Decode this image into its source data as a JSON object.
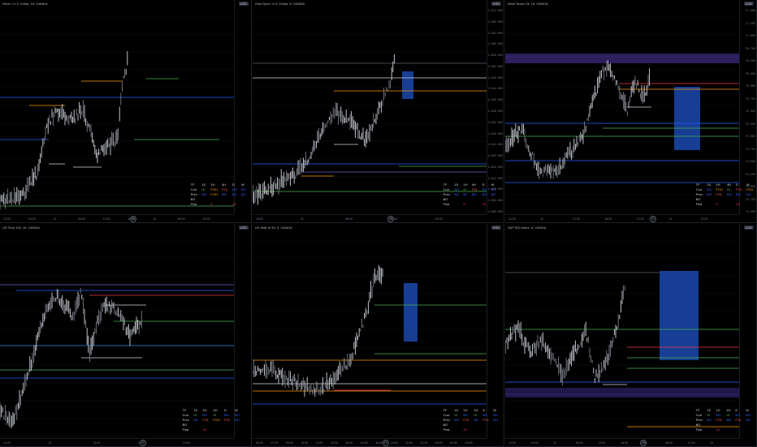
{
  "panels": [
    {
      "id": "silver",
      "title": "Silver / U.S. Dollar, 15, OANDA",
      "axis_badge": "USD",
      "price_ticks": [],
      "time_labels": [
        "12:00",
        "18:00",
        "11",
        "06:00",
        "12:00",
        "18:00",
        "14",
        "06:00",
        "12:00"
      ],
      "hud": {
        "header": [
          "TF",
          "15",
          "1H",
          "4H",
          "D",
          "W"
        ],
        "rows": [
          {
            "label": "Curr",
            "cells": [
              "HI",
              "FOH",
              "FOL",
              "BO",
              "BO"
            ]
          },
          {
            "label": "Prev",
            "cells": [
              "BO",
              "FOH",
              "BO",
              "BO",
              "BO"
            ]
          },
          {
            "label": "BO",
            "cells": []
          },
          {
            "label": "First",
            "cells": [
              "",
              "5",
              "",
              "15"
            ]
          }
        ]
      }
    },
    {
      "id": "gold",
      "title": "Gold Spot / U.S. Dollar, 5, OANDA",
      "axis_badge": "USD",
      "price_ticks": [
        "2,672.000",
        "2,668.000",
        "2,664.000",
        "2,660.000",
        "2,656.000",
        "2,652.000",
        "2,648.000",
        "2,644.000",
        "2,640.000",
        "2,636.000",
        "2,632.000",
        "2,628.000",
        "2,624.000",
        "2,620.000",
        "2,616.000",
        "2,612.000",
        "2,608.000",
        "2,604.000",
        "2,600.000"
      ],
      "time_labels": [
        "18:00",
        "11",
        "06:00",
        "12:00",
        "18:00"
      ],
      "hud": {
        "header": [
          "TF",
          "15",
          "1H",
          "4H",
          "D",
          "W"
        ],
        "rows": [
          {
            "label": "Curr",
            "cells": [
              "BO",
              "HI",
              "FOL",
              "BO",
              "BO"
            ]
          },
          {
            "label": "Prev",
            "cells": [
              "BO",
              "BL",
              "BO",
              "BO",
              "BO"
            ]
          },
          {
            "label": "BO",
            "cells": []
          },
          {
            "label": "First",
            "cells": [
              "",
              "5",
              "",
              "15"
            ]
          }
        ]
      }
    },
    {
      "id": "wti",
      "title": "West Texas Oil, 15, OANDA",
      "axis_badge": "USD",
      "price_ticks": [
        "77.500",
        "77.250",
        "77.000",
        "76.750",
        "76.500",
        "76.250",
        "76.000",
        "75.750",
        "75.500",
        "75.250",
        "75.000",
        "74.750",
        "74.500",
        "74.250",
        "74.000",
        "73.750",
        "73.500"
      ],
      "time_labels": [
        "12:00",
        "11",
        "12:00",
        "18:00",
        "12:00",
        "14",
        "12:00"
      ],
      "hud": {
        "header": [
          "TF",
          "15",
          "1H",
          "4H",
          "D",
          "W"
        ],
        "rows": [
          {
            "label": "Curr",
            "cells": [
              "BO",
              "FOH",
              "HI",
              "FOL",
              "FOH"
            ]
          },
          {
            "label": "Prev",
            "cells": [
              "BO",
              "FOL",
              "BO",
              "BO",
              "BO"
            ]
          },
          {
            "label": "BO",
            "cells": []
          },
          {
            "label": "First",
            "cells": [
              "",
              "5",
              "",
              "15"
            ]
          }
        ]
      }
    },
    {
      "id": "us-tech",
      "title": "US Tech 100, 15, OANDA",
      "axis_badge": "USD",
      "price_ticks": [],
      "time_labels": [
        "12:00",
        "13",
        "12:00",
        "11",
        "12:00"
      ],
      "hud": {
        "header": [
          "TF",
          "15",
          "1H",
          "4H",
          "D",
          "W"
        ],
        "rows": [
          {
            "label": "Curr",
            "cells": [
              "HI",
              "BO",
              "HI",
              "BO",
              "BO"
            ]
          },
          {
            "label": "Prev",
            "cells": [
              "BO",
              "FOL",
              "FOH",
              "FOL",
              "BO"
            ]
          },
          {
            "label": "BO",
            "cells": []
          },
          {
            "label": "First",
            "cells": [
              "",
              "15"
            ]
          }
        ]
      }
    },
    {
      "id": "us-wall-st",
      "title": "US Wall St 30, 5, OANDA",
      "axis_badge": "USD",
      "price_ticks": [],
      "time_labels": [
        "06:00",
        "07:30",
        "09:00",
        "10:30",
        "12:00",
        "13:30",
        "15:00",
        "16:30",
        "18:00",
        "19:30",
        "21:00",
        "22:30",
        "00:00",
        "01:30",
        "03:00"
      ],
      "hud": {
        "header": [
          "TF",
          "15",
          "1H",
          "4H",
          "D",
          "W"
        ],
        "rows": [
          {
            "label": "Curr",
            "cells": [
              "HI",
              "BO",
              "HI",
              "BO",
              "BO"
            ]
          },
          {
            "label": "Prev",
            "cells": [
              "BO",
              "FOL",
              "BO",
              "FOL",
              "BO"
            ]
          },
          {
            "label": "BO",
            "cells": []
          },
          {
            "label": "First",
            "cells": [
              "",
              "15"
            ]
          }
        ]
      }
    },
    {
      "id": "spx",
      "title": "S&P 500 Index, 5, OANDA",
      "axis_badge": "USD",
      "price_ticks": [],
      "time_labels": [
        "12:00",
        "18:00",
        "11",
        "06:00",
        "12:00",
        "18:00",
        "14",
        "06:00",
        "12:00",
        "15"
      ],
      "hud": {
        "header": [
          "TF",
          "15",
          "1H",
          "4H",
          "D",
          "W"
        ],
        "rows": [
          {
            "label": "Curr",
            "cells": [
              "HI",
              "BO",
              "HI",
              "BO",
              "BO"
            ]
          },
          {
            "label": "Prev",
            "cells": [
              "BO",
              "FOL",
              "BO",
              "FOL",
              "BO"
            ]
          },
          {
            "label": "BO",
            "cells": []
          },
          {
            "label": "First",
            "cells": [
              "",
              "15"
            ]
          }
        ]
      }
    }
  ],
  "colors": {
    "background": "#000000",
    "candle_up": "#d1d4dc",
    "candle_down": "#787b86",
    "level_blue": "#2962ff",
    "level_green": "#4caf50",
    "level_orange": "#ff9800",
    "level_red": "#f23645",
    "zone_blue": "#1e53c6",
    "zone_purple": "#3b2a7a"
  }
}
